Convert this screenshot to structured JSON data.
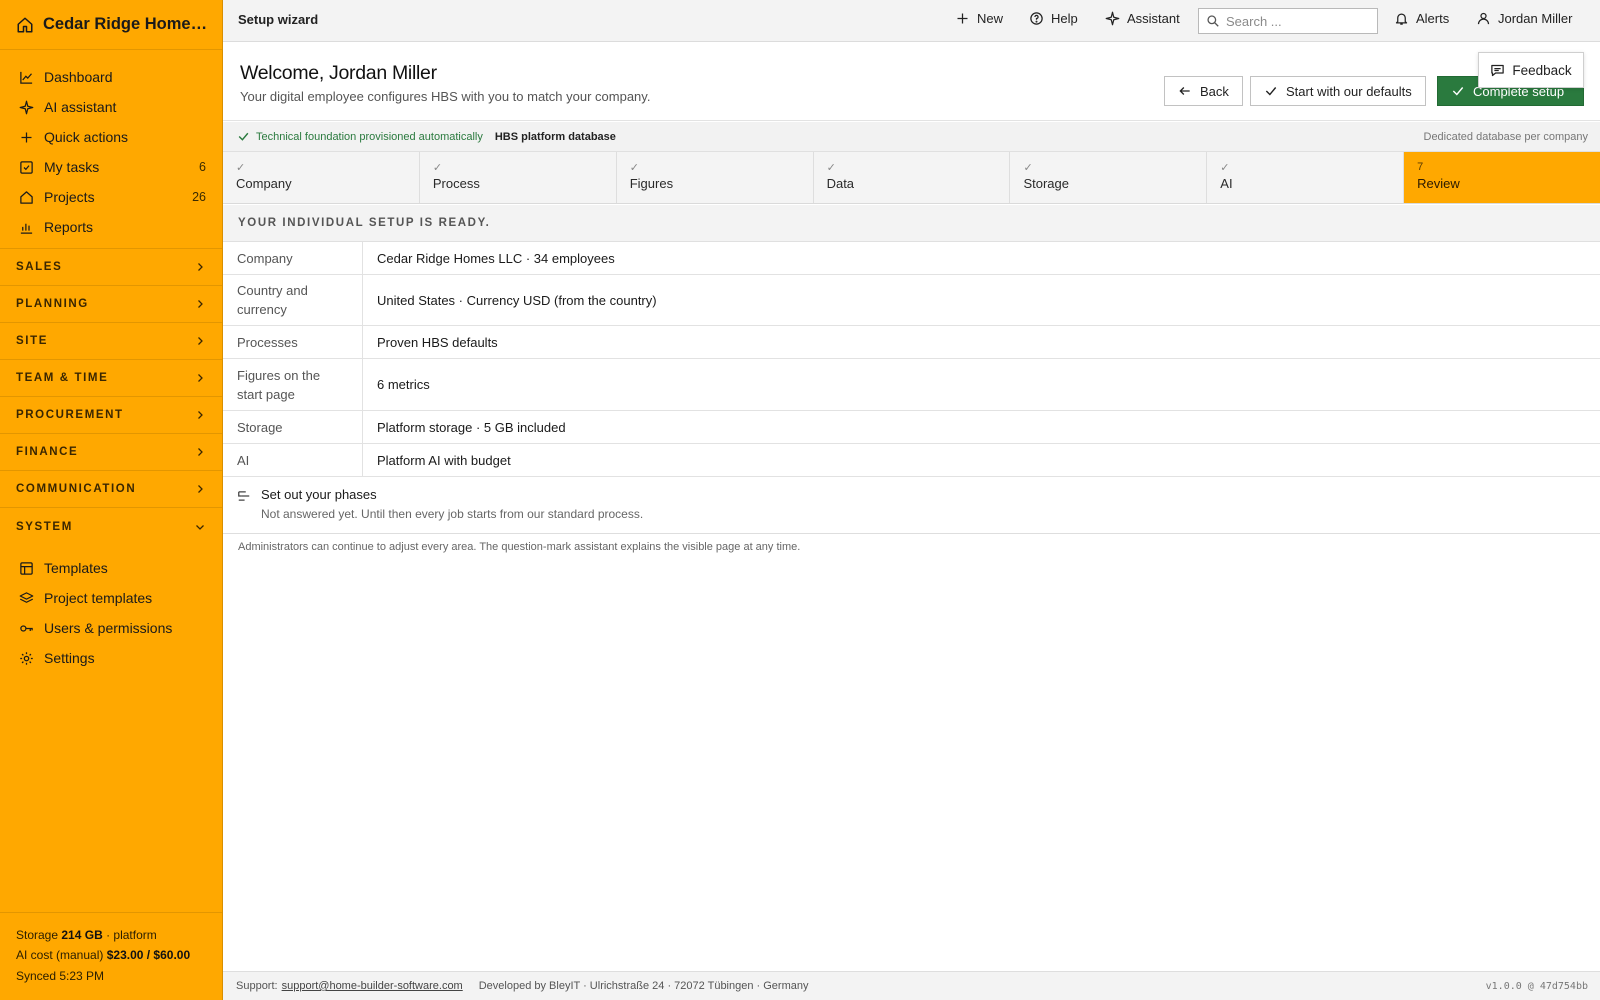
{
  "sidebar": {
    "company": "Cedar Ridge Homes LLC",
    "main_items": [
      {
        "label": "Dashboard",
        "icon": "chart-line-icon",
        "count": ""
      },
      {
        "label": "AI assistant",
        "icon": "sparkle-icon",
        "count": ""
      },
      {
        "label": "Quick actions",
        "icon": "plus-icon",
        "count": ""
      },
      {
        "label": "My tasks",
        "icon": "checkbox-icon",
        "count": "6"
      },
      {
        "label": "Projects",
        "icon": "home-icon",
        "count": "26"
      },
      {
        "label": "Reports",
        "icon": "bar-chart-icon",
        "count": ""
      }
    ],
    "sections": [
      "SALES",
      "PLANNING",
      "SITE",
      "TEAM & TIME",
      "PROCUREMENT",
      "FINANCE",
      "COMMUNICATION"
    ],
    "system_section": "SYSTEM",
    "system_items": [
      {
        "label": "Templates",
        "icon": "template-icon"
      },
      {
        "label": "Project templates",
        "icon": "layers-icon"
      },
      {
        "label": "Users & permissions",
        "icon": "key-icon"
      },
      {
        "label": "Settings",
        "icon": "gear-icon"
      }
    ],
    "footer": {
      "storage_label": "Storage",
      "storage_value": "214 GB",
      "storage_suffix": "· platform",
      "ai_label": "AI cost (manual)",
      "ai_value": "$23.00 / $60.00",
      "synced": "Synced 5:23 PM"
    }
  },
  "topbar": {
    "title": "Setup wizard",
    "new_label": "New",
    "help_label": "Help",
    "assistant_label": "Assistant",
    "search_placeholder": "Search ...",
    "alerts_label": "Alerts",
    "user_label": "Jordan Miller"
  },
  "header": {
    "title": "Welcome, Jordan Miller",
    "subtitle": "Your digital employee configures HBS with you to match your company.",
    "back_label": "Back",
    "defaults_label": "Start with our defaults",
    "complete_label": "Complete setup",
    "feedback_label": "Feedback"
  },
  "foundation": {
    "status": "Technical foundation provisioned automatically",
    "database": "HBS platform database",
    "note": "Dedicated database per company"
  },
  "steps": [
    {
      "mark": "✓",
      "label": "Company",
      "active": false
    },
    {
      "mark": "✓",
      "label": "Process",
      "active": false
    },
    {
      "mark": "✓",
      "label": "Figures",
      "active": false
    },
    {
      "mark": "✓",
      "label": "Data",
      "active": false
    },
    {
      "mark": "✓",
      "label": "Storage",
      "active": false
    },
    {
      "mark": "✓",
      "label": "AI",
      "active": false
    },
    {
      "mark": "7",
      "label": "Review",
      "active": true
    }
  ],
  "summary": {
    "heading": "YOUR INDIVIDUAL SETUP IS READY.",
    "rows": [
      {
        "key": "Company",
        "value": "Cedar Ridge Homes LLC · 34 employees"
      },
      {
        "key": "Country and currency",
        "value": "United States · Currency USD (from the country)"
      },
      {
        "key": "Processes",
        "value": "Proven HBS defaults"
      },
      {
        "key": "Figures on the start page",
        "value": "6 metrics"
      },
      {
        "key": "Storage",
        "value": "Platform storage · 5 GB included"
      },
      {
        "key": "AI",
        "value": "Platform AI with budget"
      }
    ],
    "phases_title": "Set out your phases",
    "phases_desc": "Not answered yet. Until then every job starts from our standard process.",
    "note": "Administrators can continue to adjust every area. The question-mark assistant explains the visible page at any time."
  },
  "footer": {
    "support_label": "Support:",
    "support_email": "support@home-builder-software.com",
    "developer": "Developed by BleyIT · Ulrichstraße 24 · 72072 Tübingen · Germany",
    "version": "v1.0.0 @ 47d754bb"
  },
  "colors": {
    "accent": "#ffa800",
    "primary_button": "#2a7a3e",
    "ok_text": "#2a7a3e"
  }
}
